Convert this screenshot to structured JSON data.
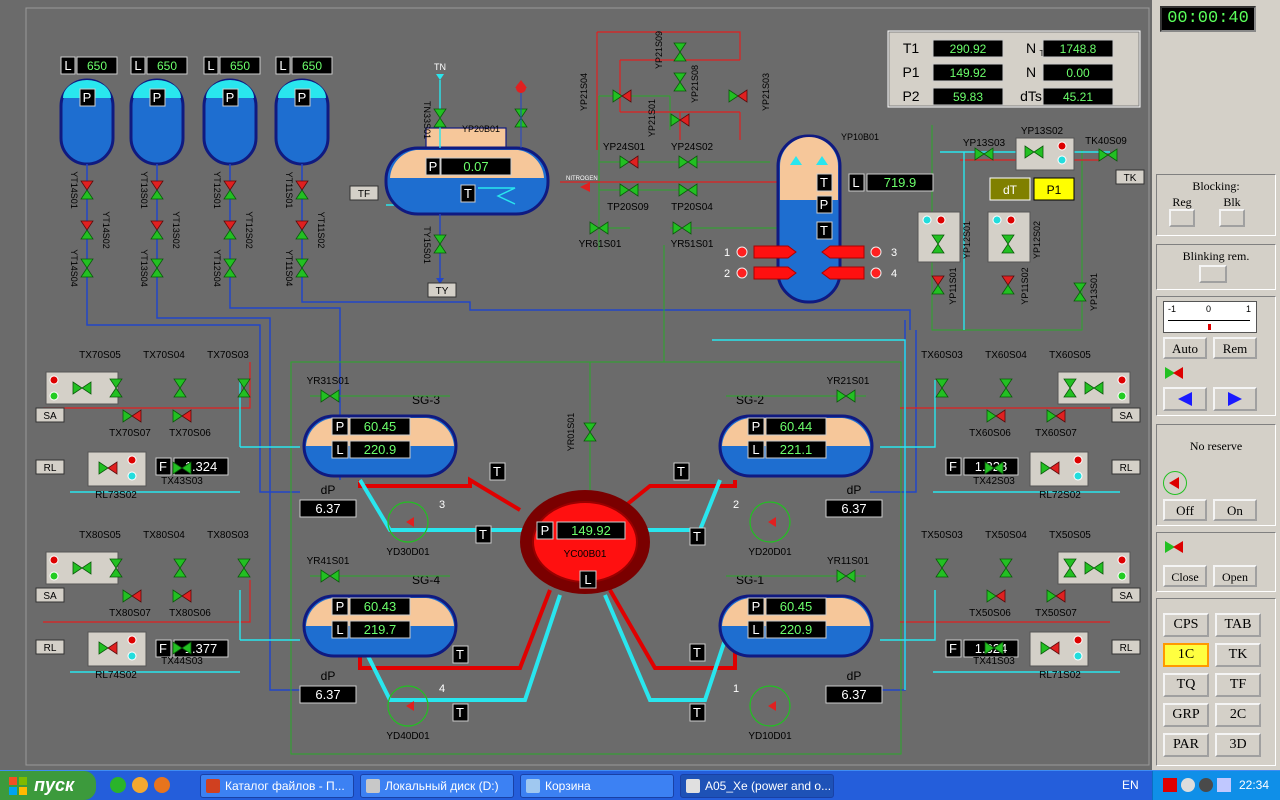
{
  "clock": "00:00:40",
  "params": [
    {
      "name": "T1",
      "value": "290.92"
    },
    {
      "name": "P1",
      "value": "149.92"
    },
    {
      "name": "P2",
      "value": "59.83"
    },
    {
      "name": "N",
      "sub": "T",
      "value": "1748.8"
    },
    {
      "name": "N",
      "value": "0.00"
    },
    {
      "name": "dTs",
      "value": "45.21"
    }
  ],
  "accumulators": [
    {
      "level": "650",
      "valve_a": "YT14S01",
      "valve_b": "YT14S02",
      "valve_c": "YT14S04"
    },
    {
      "level": "650",
      "valve_a": "YT13S01",
      "valve_b": "YT13S02",
      "valve_c": "YT13S04"
    },
    {
      "level": "650",
      "valve_a": "YT12S01",
      "valve_b": "YT12S02",
      "valve_c": "YT12S04"
    },
    {
      "level": "650",
      "valve_a": "YT11S01",
      "valve_b": "YT11S02",
      "valve_c": "YT11S04"
    }
  ],
  "tank": {
    "name": "YP20B01",
    "value": "0.07",
    "tn": "TN",
    "ty": "TY",
    "tf": "TF",
    "tn_valve": "TN33S01",
    "ty_valve": "TY15S01",
    "nitrogen": "NITROGEN"
  },
  "pressurizer": {
    "name": "YP10B01",
    "level": "719.9",
    "heaters": [
      "1",
      "2",
      "3",
      "4"
    ]
  },
  "valves_top": [
    "YP21S04",
    "YP21S09",
    "YP21S08",
    "YP21S03",
    "YP21S01",
    "YP24S01",
    "YP24S02",
    "TP20S09",
    "TP20S04",
    "YR61S01",
    "YR51S01"
  ],
  "valves_right": [
    "YP13S03",
    "YP13S02",
    "TK40S09",
    "YP12S01",
    "YP12S02",
    "YP11S01",
    "YP11S02",
    "YP13S01"
  ],
  "tk": "TK",
  "dt_label": "dT",
  "p1_label": "P1",
  "reactor": {
    "name": "YC00B01",
    "pressure": "149.92",
    "p": "P",
    "l": "L",
    "valve": "YR01S01"
  },
  "sgs": [
    {
      "name": "SG-3",
      "p": "60.45",
      "l": "220.9",
      "dp": "6.37",
      "f": "1.324",
      "loop": "3",
      "pump": "YD30D01",
      "valve": "YR31S01"
    },
    {
      "name": "SG-2",
      "p": "60.44",
      "l": "221.1",
      "dp": "6.37",
      "f": "1.328",
      "loop": "2",
      "pump": "YD20D01",
      "valve": "YR21S01"
    },
    {
      "name": "SG-4",
      "p": "60.43",
      "l": "219.7",
      "dp": "6.37",
      "f": "1.377",
      "loop": "4",
      "pump": "YD40D01",
      "valve": "YR41S01"
    },
    {
      "name": "SG-1",
      "p": "60.45",
      "l": "220.9",
      "dp": "6.37",
      "f": "1.324",
      "loop": "1",
      "pump": "YD10D01",
      "valve": "YR11S01"
    }
  ],
  "steam_groups": {
    "left_top": {
      "v": [
        "TX70S05",
        "TX70S04",
        "TX70S03",
        "TX70S07",
        "TX70S06"
      ],
      "rl": "RL73S02",
      "sub": "TX43S03"
    },
    "left_bot": {
      "v": [
        "TX80S05",
        "TX80S04",
        "TX80S03",
        "TX80S07",
        "TX80S06"
      ],
      "rl": "RL74S02",
      "sub": "TX44S03"
    },
    "right_top": {
      "v": [
        "TX60S03",
        "TX60S04",
        "TX60S05",
        "TX60S06",
        "TX60S07"
      ],
      "rl": "RL72S02",
      "sub": "TX42S03"
    },
    "right_bot": {
      "v": [
        "TX50S03",
        "TX50S04",
        "TX50S05",
        "TX50S06",
        "TX50S07"
      ],
      "rl": "RL71S02",
      "sub": "TX41S03"
    }
  },
  "tags": {
    "sa": "SA",
    "rl": "RL",
    "f": "F",
    "dp": "dP",
    "t": "T",
    "p": "P",
    "l": "L"
  },
  "right_panel": {
    "blocking": "Blocking:",
    "reg": "Reg",
    "blk": "Blk",
    "blinking": "Blinking rem.",
    "scale": [
      "-1",
      "0",
      "1"
    ],
    "auto": "Auto",
    "rem": "Rem",
    "no_reserve": "No reserve",
    "off": "Off",
    "on": "On",
    "close": "Close",
    "open": "Open",
    "nav": [
      [
        "CPS",
        "TAB"
      ],
      [
        "1C",
        "TK"
      ],
      [
        "TQ",
        "TF"
      ],
      [
        "GRP",
        "2C"
      ],
      [
        "PAR",
        "3D"
      ]
    ],
    "active_nav": "1C"
  },
  "taskbar": {
    "start": "пуск",
    "tasks": [
      "Каталог файлов - П...",
      "Локальный диск (D:)",
      "Корзина",
      "A05_Xe (power and o..."
    ],
    "lang": "EN",
    "time": "22:34"
  },
  "colors": {
    "hot": "#e00000",
    "cold": "#29e6ee",
    "steam": "#2346c8",
    "water": "#2270c8",
    "steam_space": "#f6c79a",
    "valve_green": "#22c022",
    "display_bg": "#000000",
    "display_fg": "#6cff6c"
  }
}
